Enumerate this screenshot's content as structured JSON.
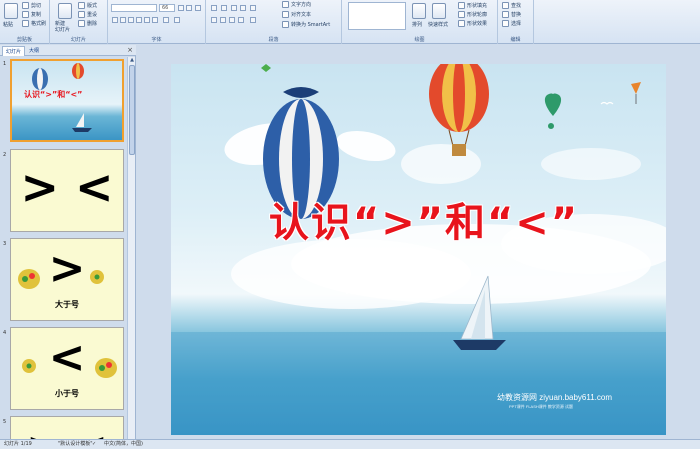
{
  "ribbon": {
    "clipboard": {
      "paste": "粘贴",
      "cut": "剪切",
      "copy": "复制",
      "format_painter": "格式刷",
      "label": "剪贴板"
    },
    "slides": {
      "new_slide": "新建\n幻灯片",
      "layout": "版式",
      "reset": "重设",
      "delete": "删除",
      "label": "幻灯片"
    },
    "font": {
      "font_name": "",
      "font_size": "66",
      "label": "字体"
    },
    "paragraph": {
      "text_direction": "文字方向",
      "align_text": "对齐文本",
      "convert_smartart": "转换为 SmartArt",
      "label": "段落"
    },
    "drawing": {
      "arrange": "排列",
      "quick_styles": "快速样式",
      "shape_fill": "形状填充",
      "shape_outline": "形状轮廓",
      "shape_effects": "形状效果",
      "label": "绘图"
    },
    "editing": {
      "find": "查找",
      "replace": "替换",
      "select": "选择",
      "label": "编辑"
    }
  },
  "pane": {
    "tabs": [
      "幻灯片",
      "大纲"
    ],
    "thumbnails": [
      {
        "num": "1",
        "title": "认识“>”和“<”"
      },
      {
        "num": "2",
        "symbols": "> <"
      },
      {
        "num": "3",
        "symbol": ">",
        "caption": "大于号"
      },
      {
        "num": "4",
        "symbol": "<",
        "caption": "小于号"
      },
      {
        "num": "5",
        "symbols": "> <"
      }
    ]
  },
  "slide": {
    "title": "认识“>”和“<”",
    "watermark": "幼教资源网 ziyuan.baby611.com",
    "watermark_sub": "PPT课件  FLASH课件  教学资源  试题"
  },
  "status": {
    "slide_info": "幻灯片 1/19",
    "theme": "\"默认设计模板\"",
    "language": "中文(简体，中国)"
  },
  "colors": {
    "title_red": "#e8141c",
    "ribbon_blue": "#15428b",
    "thumb_bg": "#fafad2",
    "selection": "#f0a030"
  }
}
